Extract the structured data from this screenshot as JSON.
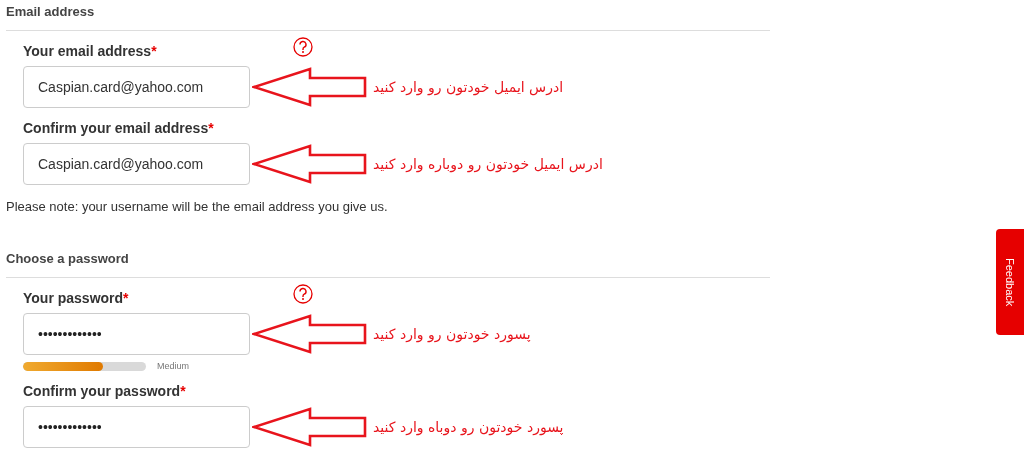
{
  "sections": [
    {
      "title": "Email address",
      "fields": [
        {
          "kind": "text",
          "label": "Your email address",
          "required_mark": "*",
          "help": true,
          "value": "Caspian.card@yahoo.com",
          "annotation": "ادرس ایمیل خودتون رو وارد کنید"
        },
        {
          "kind": "text",
          "label": "Confirm your email address",
          "required_mark": "*",
          "help": false,
          "value": "Caspian.card@yahoo.com",
          "annotation": "ادرس ایمیل خودتون رو  دوباره وارد کنید"
        }
      ],
      "note": "Please note: your username will be the email address you give us."
    },
    {
      "title": "Choose a password",
      "fields": [
        {
          "kind": "password",
          "label": "Your password",
          "required_mark": "*",
          "help": true,
          "value": "•••••••••••••",
          "annotation": "پسورد خودتون رو وارد کنید",
          "strength": {
            "level": 0.65,
            "label": "Medium"
          }
        },
        {
          "kind": "password",
          "label": "Confirm your password",
          "required_mark": "*",
          "help": false,
          "value": "•••••••••••••",
          "annotation": "پسورد خودتون رو دوباه وارد کنید"
        }
      ]
    }
  ],
  "feedback_tab": {
    "label": "Feedback"
  }
}
